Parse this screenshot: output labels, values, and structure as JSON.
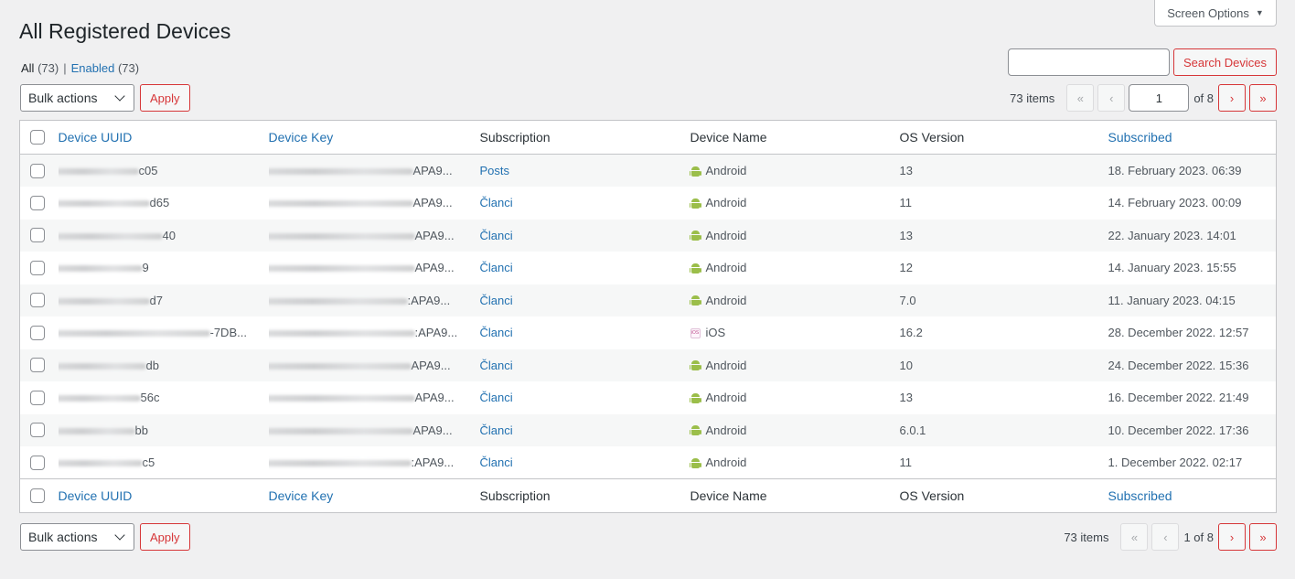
{
  "header": {
    "title": "All Registered Devices",
    "screen_options": "Screen Options"
  },
  "views": {
    "all_label": "All",
    "all_count": "(73)",
    "separator": "|",
    "enabled_label": "Enabled",
    "enabled_count": "(73)"
  },
  "search": {
    "value": "",
    "button": "Search Devices"
  },
  "bulk": {
    "select_value": "Bulk actions",
    "apply": "Apply"
  },
  "pagination_top": {
    "items": "73 items",
    "first": "«",
    "prev": "‹",
    "current_page": "1",
    "of_text": "of 8",
    "next": "›",
    "last": "»"
  },
  "pagination_bottom": {
    "items": "73 items",
    "first": "«",
    "prev": "‹",
    "page_text": "1 of 8",
    "next": "›",
    "last": "»"
  },
  "columns": {
    "uuid": "Device UUID",
    "key": "Device Key",
    "subscription": "Subscription",
    "name": "Device Name",
    "os_version": "OS Version",
    "subscribed": "Subscribed"
  },
  "rows": [
    {
      "uuid_tail": "c05",
      "key_tail": "APA9...",
      "subscription": "Posts",
      "os_icon": "android-icon",
      "device": "Android",
      "version": "13",
      "subscribed": "18. February 2023. 06:39"
    },
    {
      "uuid_tail": "d65",
      "key_tail": "APA9...",
      "subscription": "Članci",
      "os_icon": "android-icon",
      "device": "Android",
      "version": "11",
      "subscribed": "14. February 2023. 00:09"
    },
    {
      "uuid_tail": "40",
      "key_tail": "APA9...",
      "subscription": "Članci",
      "os_icon": "android-icon",
      "device": "Android",
      "version": "13",
      "subscribed": "22. January 2023. 14:01"
    },
    {
      "uuid_tail": "9",
      "key_tail": "APA9...",
      "subscription": "Članci",
      "os_icon": "android-icon",
      "device": "Android",
      "version": "12",
      "subscribed": "14. January 2023. 15:55"
    },
    {
      "uuid_tail": "d7",
      "key_tail": ":APA9...",
      "subscription": "Članci",
      "os_icon": "android-icon",
      "device": "Android",
      "version": "7.0",
      "subscribed": "11. January 2023. 04:15"
    },
    {
      "uuid_tail": "-7DB...",
      "key_tail": ":APA9...",
      "subscription": "Članci",
      "os_icon": "ios-icon",
      "device": "iOS",
      "version": "16.2",
      "subscribed": "28. December 2022. 12:57"
    },
    {
      "uuid_tail": "db",
      "key_tail": "APA9...",
      "subscription": "Članci",
      "os_icon": "android-icon",
      "device": "Android",
      "version": "10",
      "subscribed": "24. December 2022. 15:36"
    },
    {
      "uuid_tail": "56c",
      "key_tail": "APA9...",
      "subscription": "Članci",
      "os_icon": "android-icon",
      "device": "Android",
      "version": "13",
      "subscribed": "16. December 2022. 21:49"
    },
    {
      "uuid_tail": "bb",
      "key_tail": "APA9...",
      "subscription": "Članci",
      "os_icon": "android-icon",
      "device": "Android",
      "version": "6.0.1",
      "subscribed": "10. December 2022. 17:36"
    },
    {
      "uuid_tail": "c5",
      "key_tail": ":APA9...",
      "subscription": "Članci",
      "os_icon": "android-icon",
      "device": "Android",
      "version": "11",
      "subscribed": "1. December 2022. 02:17"
    }
  ],
  "colors": {
    "link": "#2271b1",
    "danger": "#d63638",
    "android": "#9bbe4a"
  }
}
